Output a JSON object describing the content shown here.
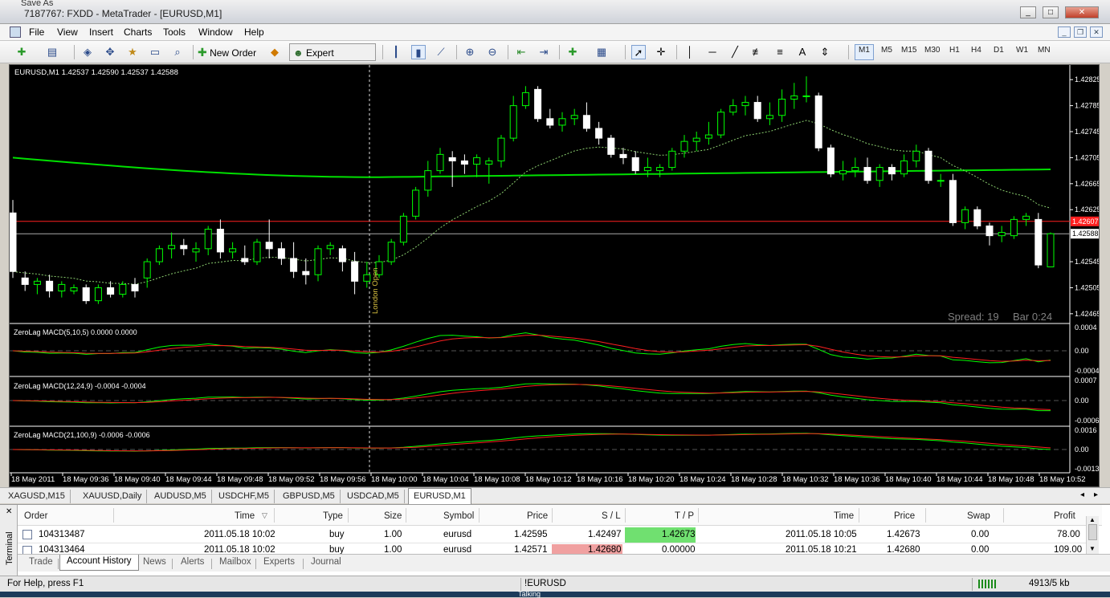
{
  "window": {
    "title": "7187767: FXDD - MetaTrader - [EURUSD,M1]",
    "ghost_title": "Save As"
  },
  "menu": [
    "File",
    "View",
    "Insert",
    "Charts",
    "Tools",
    "Window",
    "Help"
  ],
  "toolbar": {
    "new_order": "New Order",
    "expert_advisors": "Expert Advisors",
    "text_tool": "A",
    "timeframes": [
      "M1",
      "M5",
      "M15",
      "M30",
      "H1",
      "H4",
      "D1",
      "W1",
      "MN"
    ],
    "active_timeframe": "M1"
  },
  "chart": {
    "header": "EURUSD,M1  1.42537 1.42590 1.42537 1.42588",
    "spread": "Spread: 19",
    "bar_timer": "Bar  0:24",
    "event_label": "London Open",
    "bid_label": "1.42607",
    "current_label": "1.42588",
    "price_ticks": [
      "1.42825",
      "1.42785",
      "1.42745",
      "1.42705",
      "1.42665",
      "1.42625",
      "1.42545",
      "1.42505",
      "1.42465"
    ],
    "macd_panels": [
      {
        "label": "ZeroLag MACD(5,10,5) 0.0000 0.0000",
        "ticks": [
          "0.0004",
          "0.00",
          "-0.0004"
        ]
      },
      {
        "label": "ZeroLag MACD(12,24,9) -0.0004 -0.0004",
        "ticks": [
          "0.0007",
          "0.00",
          "-0.0006"
        ]
      },
      {
        "label": "ZeroLag MACD(21,100,9) -0.0006 -0.0006",
        "ticks": [
          "0.0016",
          "0.00",
          "-0.0013"
        ]
      }
    ],
    "time_labels": [
      "18 May 2011",
      "18 May 09:36",
      "18 May 09:40",
      "18 May 09:44",
      "18 May 09:48",
      "18 May 09:52",
      "18 May 09:56",
      "18 May 10:00",
      "18 May 10:04",
      "18 May 10:08",
      "18 May 10:12",
      "18 May 10:16",
      "18 May 10:20",
      "18 May 10:24",
      "18 May 10:28",
      "18 May 10:32",
      "18 May 10:36",
      "18 May 10:40",
      "18 May 10:44",
      "18 May 10:48",
      "18 May 10:52"
    ],
    "colors": {
      "bg": "#000000",
      "up": "#00ff00",
      "down": "#ffffff",
      "ma": "#00e000",
      "grid": "#555555",
      "bid": "#ff2020",
      "macd": "#00ff00",
      "signal": "#ff2020"
    }
  },
  "symbol_tabs": [
    "XAGUSD,M15",
    "XAUUSD,Daily",
    "AUDUSD,M5",
    "USDCHF,M5",
    "GBPUSD,M5",
    "USDCAD,M5",
    "EURUSD,M1"
  ],
  "active_symbol_tab": "EURUSD,M1",
  "terminal": {
    "side_label": "Terminal",
    "columns": [
      "Order",
      "Time",
      "Type",
      "Size",
      "Symbol",
      "Price",
      "S / L",
      "T / P",
      "Time",
      "Price",
      "Swap",
      "Profit"
    ],
    "rows": [
      {
        "order": "104313487",
        "time": "2011.05.18 10:02",
        "type": "buy",
        "size": "1.00",
        "symbol": "eurusd",
        "price": "1.42595",
        "sl": "1.42497",
        "tp": "1.42673",
        "ctime": "2011.05.18 10:05",
        "cprice": "1.42673",
        "swap": "0.00",
        "profit": "78.00"
      },
      {
        "order": "104313464",
        "time": "2011.05.18 10:02",
        "type": "buy",
        "size": "1.00",
        "symbol": "eurusd",
        "price": "1.42571",
        "sl": "1.42680",
        "tp": "0.00000",
        "ctime": "2011.05.18 10:21",
        "cprice": "1.42680",
        "swap": "0.00",
        "profit": "109.00"
      }
    ],
    "tabs": [
      "Trade",
      "Account History",
      "News",
      "Alerts",
      "Mailbox",
      "Experts",
      "Journal"
    ],
    "active_tab": "Account History"
  },
  "status": {
    "help": "For Help, press F1",
    "profile": "!EURUSD",
    "traffic": "4913/5 kb",
    "taskbar_fragment": "Talking"
  },
  "candles": [
    [
      1.4262,
      1.4264,
      1.4252,
      1.4253
    ],
    [
      1.4252,
      1.4253,
      1.425,
      1.4251
    ],
    [
      1.4251,
      1.4252,
      1.42495,
      1.42515
    ],
    [
      1.42515,
      1.42525,
      1.4249,
      1.425
    ],
    [
      1.425,
      1.42515,
      1.4249,
      1.4251
    ],
    [
      1.425,
      1.4251,
      1.42495,
      1.42505
    ],
    [
      1.42505,
      1.4251,
      1.4248,
      1.42485
    ],
    [
      1.42485,
      1.4251,
      1.4248,
      1.42505
    ],
    [
      1.42505,
      1.42515,
      1.4249,
      1.42495
    ],
    [
      1.42495,
      1.42515,
      1.4249,
      1.4251
    ],
    [
      1.4251,
      1.4252,
      1.4249,
      1.425
    ],
    [
      1.4252,
      1.4255,
      1.42505,
      1.42545
    ],
    [
      1.42545,
      1.4257,
      1.4254,
      1.42565
    ],
    [
      1.42565,
      1.4259,
      1.4255,
      1.4257
    ],
    [
      1.4257,
      1.4258,
      1.42555,
      1.42565
    ],
    [
      1.4256,
      1.42575,
      1.42545,
      1.42565
    ],
    [
      1.42565,
      1.426,
      1.42555,
      1.42595
    ],
    [
      1.42595,
      1.4261,
      1.4255,
      1.4256
    ],
    [
      1.4256,
      1.42575,
      1.4255,
      1.42565
    ],
    [
      1.4255,
      1.4257,
      1.4254,
      1.42545
    ],
    [
      1.42545,
      1.4258,
      1.4254,
      1.42575
    ],
    [
      1.42575,
      1.4261,
      1.4255,
      1.42565
    ],
    [
      1.42565,
      1.42575,
      1.4254,
      1.4255
    ],
    [
      1.4255,
      1.42575,
      1.4252,
      1.4253
    ],
    [
      1.4253,
      1.4255,
      1.4251,
      1.42525
    ],
    [
      1.42525,
      1.4257,
      1.42515,
      1.42565
    ],
    [
      1.42565,
      1.42575,
      1.42555,
      1.4257
    ],
    [
      1.42565,
      1.4257,
      1.4253,
      1.42545
    ],
    [
      1.42545,
      1.4256,
      1.42495,
      1.42515
    ],
    [
      1.42515,
      1.42545,
      1.42505,
      1.42525
    ],
    [
      1.42525,
      1.42555,
      1.4252,
      1.42545
    ],
    [
      1.42545,
      1.4258,
      1.4254,
      1.42575
    ],
    [
      1.42575,
      1.4262,
      1.4257,
      1.42615
    ],
    [
      1.42615,
      1.4266,
      1.4261,
      1.42655
    ],
    [
      1.42655,
      1.427,
      1.42645,
      1.42685
    ],
    [
      1.42685,
      1.4272,
      1.4268,
      1.4271
    ],
    [
      1.42705,
      1.42715,
      1.4266,
      1.427
    ],
    [
      1.427,
      1.4271,
      1.4268,
      1.42695
    ],
    [
      1.42695,
      1.4271,
      1.42675,
      1.42705
    ],
    [
      1.42695,
      1.42705,
      1.42665,
      1.427
    ],
    [
      1.427,
      1.4274,
      1.4269,
      1.42735
    ],
    [
      1.42735,
      1.428,
      1.4273,
      1.42785
    ],
    [
      1.42785,
      1.42815,
      1.4278,
      1.42805
    ],
    [
      1.4281,
      1.42815,
      1.4276,
      1.42765
    ],
    [
      1.42765,
      1.4278,
      1.4275,
      1.42755
    ],
    [
      1.42755,
      1.42775,
      1.42745,
      1.42765
    ],
    [
      1.42765,
      1.4278,
      1.42755,
      1.4277
    ],
    [
      1.4277,
      1.4279,
      1.42745,
      1.4275
    ],
    [
      1.4275,
      1.4276,
      1.42725,
      1.42735
    ],
    [
      1.42735,
      1.4274,
      1.42705,
      1.4271
    ],
    [
      1.4271,
      1.4272,
      1.42695,
      1.42705
    ],
    [
      1.42705,
      1.42715,
      1.4268,
      1.42685
    ],
    [
      1.42685,
      1.42705,
      1.42675,
      1.4269
    ],
    [
      1.42685,
      1.42695,
      1.42675,
      1.4269
    ],
    [
      1.4269,
      1.4272,
      1.42685,
      1.42715
    ],
    [
      1.42715,
      1.4274,
      1.42705,
      1.4273
    ],
    [
      1.4273,
      1.42745,
      1.42715,
      1.42735
    ],
    [
      1.42735,
      1.4276,
      1.42725,
      1.4274
    ],
    [
      1.4274,
      1.4278,
      1.42735,
      1.42775
    ],
    [
      1.42775,
      1.42795,
      1.4277,
      1.42785
    ],
    [
      1.42785,
      1.428,
      1.4277,
      1.4279
    ],
    [
      1.4279,
      1.428,
      1.4276,
      1.42765
    ],
    [
      1.42765,
      1.4279,
      1.42755,
      1.4277
    ],
    [
      1.4277,
      1.4281,
      1.4276,
      1.42795
    ],
    [
      1.42795,
      1.4282,
      1.4278,
      1.428
    ],
    [
      1.428,
      1.4283,
      1.4279,
      1.428
    ],
    [
      1.428,
      1.42805,
      1.42715,
      1.4272
    ],
    [
      1.4272,
      1.42725,
      1.42675,
      1.4268
    ],
    [
      1.4268,
      1.427,
      1.4267,
      1.42685
    ],
    [
      1.42685,
      1.42705,
      1.42675,
      1.4269
    ],
    [
      1.4269,
      1.42705,
      1.42665,
      1.4267
    ],
    [
      1.4267,
      1.42695,
      1.4266,
      1.4269
    ],
    [
      1.4269,
      1.42695,
      1.4267,
      1.4268
    ],
    [
      1.4268,
      1.4271,
      1.42675,
      1.427
    ],
    [
      1.427,
      1.42725,
      1.4269,
      1.42715
    ],
    [
      1.42715,
      1.4272,
      1.42665,
      1.4267
    ],
    [
      1.4267,
      1.4268,
      1.4266,
      1.4267
    ],
    [
      1.4267,
      1.4268,
      1.426,
      1.42605
    ],
    [
      1.42605,
      1.4263,
      1.42595,
      1.42625
    ],
    [
      1.42625,
      1.4263,
      1.42595,
      1.426
    ],
    [
      1.426,
      1.42605,
      1.4257,
      1.42585
    ],
    [
      1.42585,
      1.426,
      1.42575,
      1.4259
    ],
    [
      1.42585,
      1.42615,
      1.4258,
      1.4261
    ],
    [
      1.4261,
      1.4262,
      1.426,
      1.42615
    ],
    [
      1.4261,
      1.4262,
      1.42535,
      1.4254
    ],
    [
      1.42537,
      1.4259,
      1.42537,
      1.42588
    ]
  ]
}
